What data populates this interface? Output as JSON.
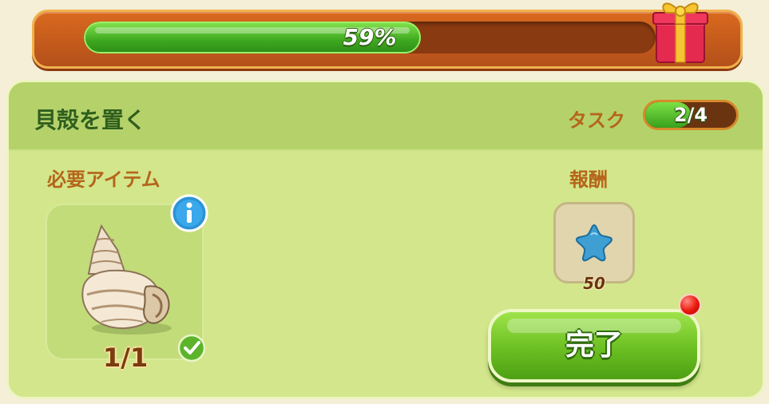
{
  "progress": {
    "percent_label": "59%",
    "fraction": 0.59,
    "reward_icon": "gift-box-icon"
  },
  "task": {
    "title": "貝殻を置く",
    "counter_label": "タスク",
    "counter_value": "2/4",
    "counter_fraction": 0.5
  },
  "required": {
    "label": "必要アイテム",
    "item_icon": "seashell-icon",
    "count": "1/1",
    "info_icon": "info-icon",
    "check_icon": "checkmark-icon"
  },
  "reward": {
    "label": "報酬",
    "icon": "blue-star-icon",
    "amount": "50"
  },
  "actions": {
    "complete_label": "完了",
    "notification_icon": "red-dot-icon"
  },
  "colors": {
    "progress_green": "#3ea820",
    "banner_orange": "#d9691e",
    "card_green": "#d3e68b",
    "header_green": "#b5d26a",
    "label_orange": "#b5651a",
    "title_green": "#2f5e1e"
  }
}
